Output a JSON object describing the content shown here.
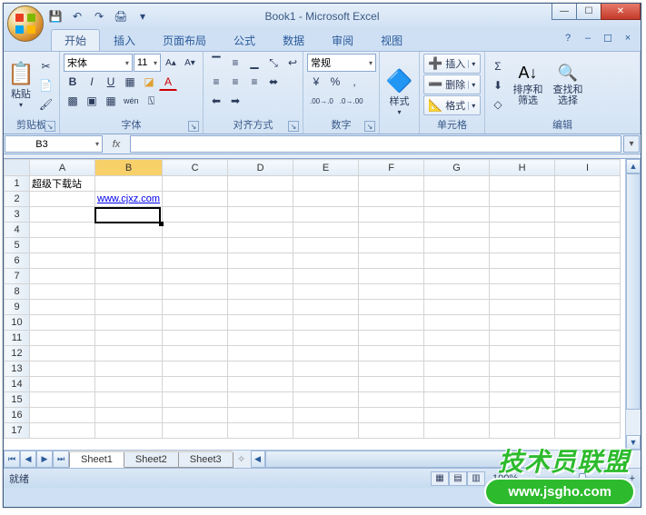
{
  "title": "Book1 - Microsoft Excel",
  "qat": {
    "save": "💾",
    "undo": "↶",
    "redo": "↷",
    "print": "🖨",
    "more": "▾"
  },
  "win": {
    "min": "—",
    "max": "☐",
    "close": "✕"
  },
  "tabs": {
    "items": [
      "开始",
      "插入",
      "页面布局",
      "公式",
      "数据",
      "审阅",
      "视图"
    ],
    "active_index": 0,
    "help": "?",
    "mdi_min": "–",
    "mdi_max": "☐",
    "mdi_close": "×"
  },
  "ribbon": {
    "clipboard": {
      "label": "剪贴板",
      "paste": "粘贴",
      "paste_icon": "📋",
      "cut": "✂",
      "copy": "📄",
      "format": "🖌"
    },
    "font": {
      "label": "字体",
      "name": "宋体",
      "size": "11",
      "grow": "A▴",
      "shrink": "A▾",
      "bold": "B",
      "italic": "I",
      "underline": "U",
      "border": "▦",
      "fill": "◪",
      "color": "A",
      "db_border": "▩",
      "ruby": "wén",
      "phonetic": "⍂"
    },
    "align": {
      "label": "对齐方式",
      "top": "▔",
      "mid": "≡",
      "bot": "▁",
      "left": "≡",
      "center": "≡",
      "right": "≡",
      "dec": "⬅",
      "inc": "➡",
      "orient": "⤡",
      "wrap": "↩",
      "merge": "⬌"
    },
    "number": {
      "label": "数字",
      "format": "常规",
      "currency": "¥",
      "percent": "%",
      "comma": ",",
      "inc_dec": ".00→.0",
      "dec_dec": ".0→.00"
    },
    "styles": {
      "label": "样式",
      "btn": "样式",
      "icon": "🔷"
    },
    "cells": {
      "label": "单元格",
      "insert": "插入",
      "delete": "删除",
      "format": "格式",
      "ins_icon": "➕",
      "del_icon": "➖",
      "fmt_icon": "📐"
    },
    "editing": {
      "label": "编辑",
      "sum": "Σ",
      "fill": "⬇",
      "clear": "◇",
      "sort": "排序和\n筛选",
      "sort_icon": "A↓",
      "find": "查找和\n选择",
      "find_icon": "🔍"
    }
  },
  "namebox": "B3",
  "fx_label": "fx",
  "columns": [
    "A",
    "B",
    "C",
    "D",
    "E",
    "F",
    "G",
    "H",
    "I"
  ],
  "rows": 17,
  "cells": {
    "A1": "超级下载站",
    "B2": "www.cjxz.com"
  },
  "active": {
    "col": 1,
    "row": 2
  },
  "sheets": {
    "items": [
      "Sheet1",
      "Sheet2",
      "Sheet3"
    ],
    "active_index": 0,
    "new": "✧"
  },
  "status": {
    "ready": "就绪",
    "zoom": "100%",
    "plus": "+",
    "minus": "−"
  },
  "watermark": {
    "text": "技术员联盟",
    "url": "www.jsgho.com"
  }
}
